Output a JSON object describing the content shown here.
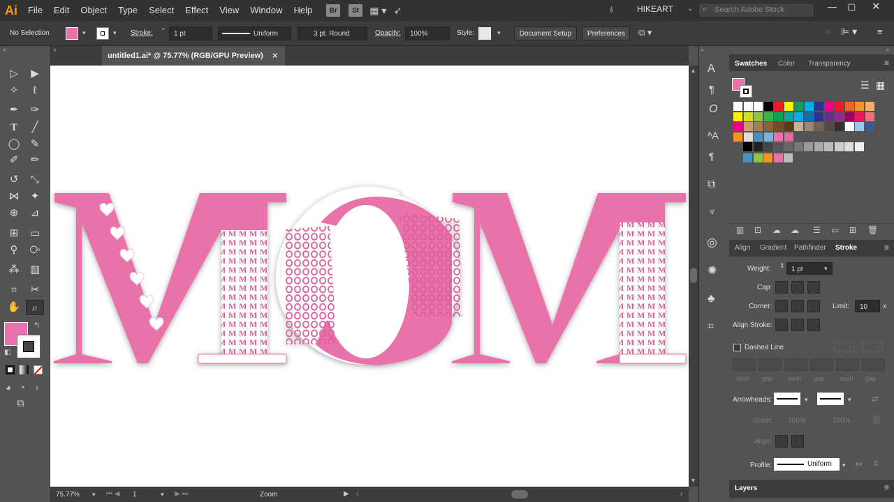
{
  "app": {
    "logo": "Ai",
    "workspace": "HIKEART",
    "search_placeholder": "Search Adobe Stock",
    "badge_br": "Br",
    "badge_st": "St"
  },
  "menu": [
    "File",
    "Edit",
    "Object",
    "Type",
    "Select",
    "Effect",
    "View",
    "Window",
    "Help"
  ],
  "control": {
    "selection": "No Selection",
    "stroke_label": "Stroke:",
    "stroke_value": "1 pt",
    "profile_value": "Uniform",
    "brush_value": "3 pt. Round",
    "opacity_label": "Opacity:",
    "opacity_value": "100%",
    "style_label": "Style:",
    "doc_setup": "Document Setup",
    "preferences": "Preferences"
  },
  "document": {
    "tab_title": "untitled1.ai* @ 75.77% (RGB/GPU Preview)",
    "close": "×"
  },
  "artwork": {
    "word": "MOM",
    "fill_m": "MMMM",
    "fill_o": "OOOO",
    "color": "#e972ab"
  },
  "status": {
    "zoom": "75.77%",
    "artboard": "1",
    "tool": "Zoom"
  },
  "panels": {
    "tabs_top": [
      "Swatches",
      "Color",
      "Transparency"
    ],
    "tabs_bottom": [
      "Align",
      "Gradient",
      "Pathfinder",
      "Stroke"
    ],
    "weight_label": "Weight:",
    "weight_value": "1 pt",
    "cap_label": "Cap:",
    "corner_label": "Corner:",
    "limit_label": "Limit:",
    "limit_value": "10",
    "limit_x": "x",
    "align_label": "Align Stroke:",
    "dashed_label": "Dashed Line",
    "dash_labels": [
      "dash",
      "gap",
      "dash",
      "gap",
      "dash",
      "gap"
    ],
    "arrowheads_label": "Arrowheads:",
    "scale_label": "Scale:",
    "scale_values": [
      "100%",
      "100%"
    ],
    "align_arrow_label": "Align:",
    "profile_label": "Profile:",
    "profile_value": "Uniform",
    "layers_tab": "Layers"
  },
  "colors": {
    "fill": "#e972ab",
    "accent": "#ff9a00"
  }
}
